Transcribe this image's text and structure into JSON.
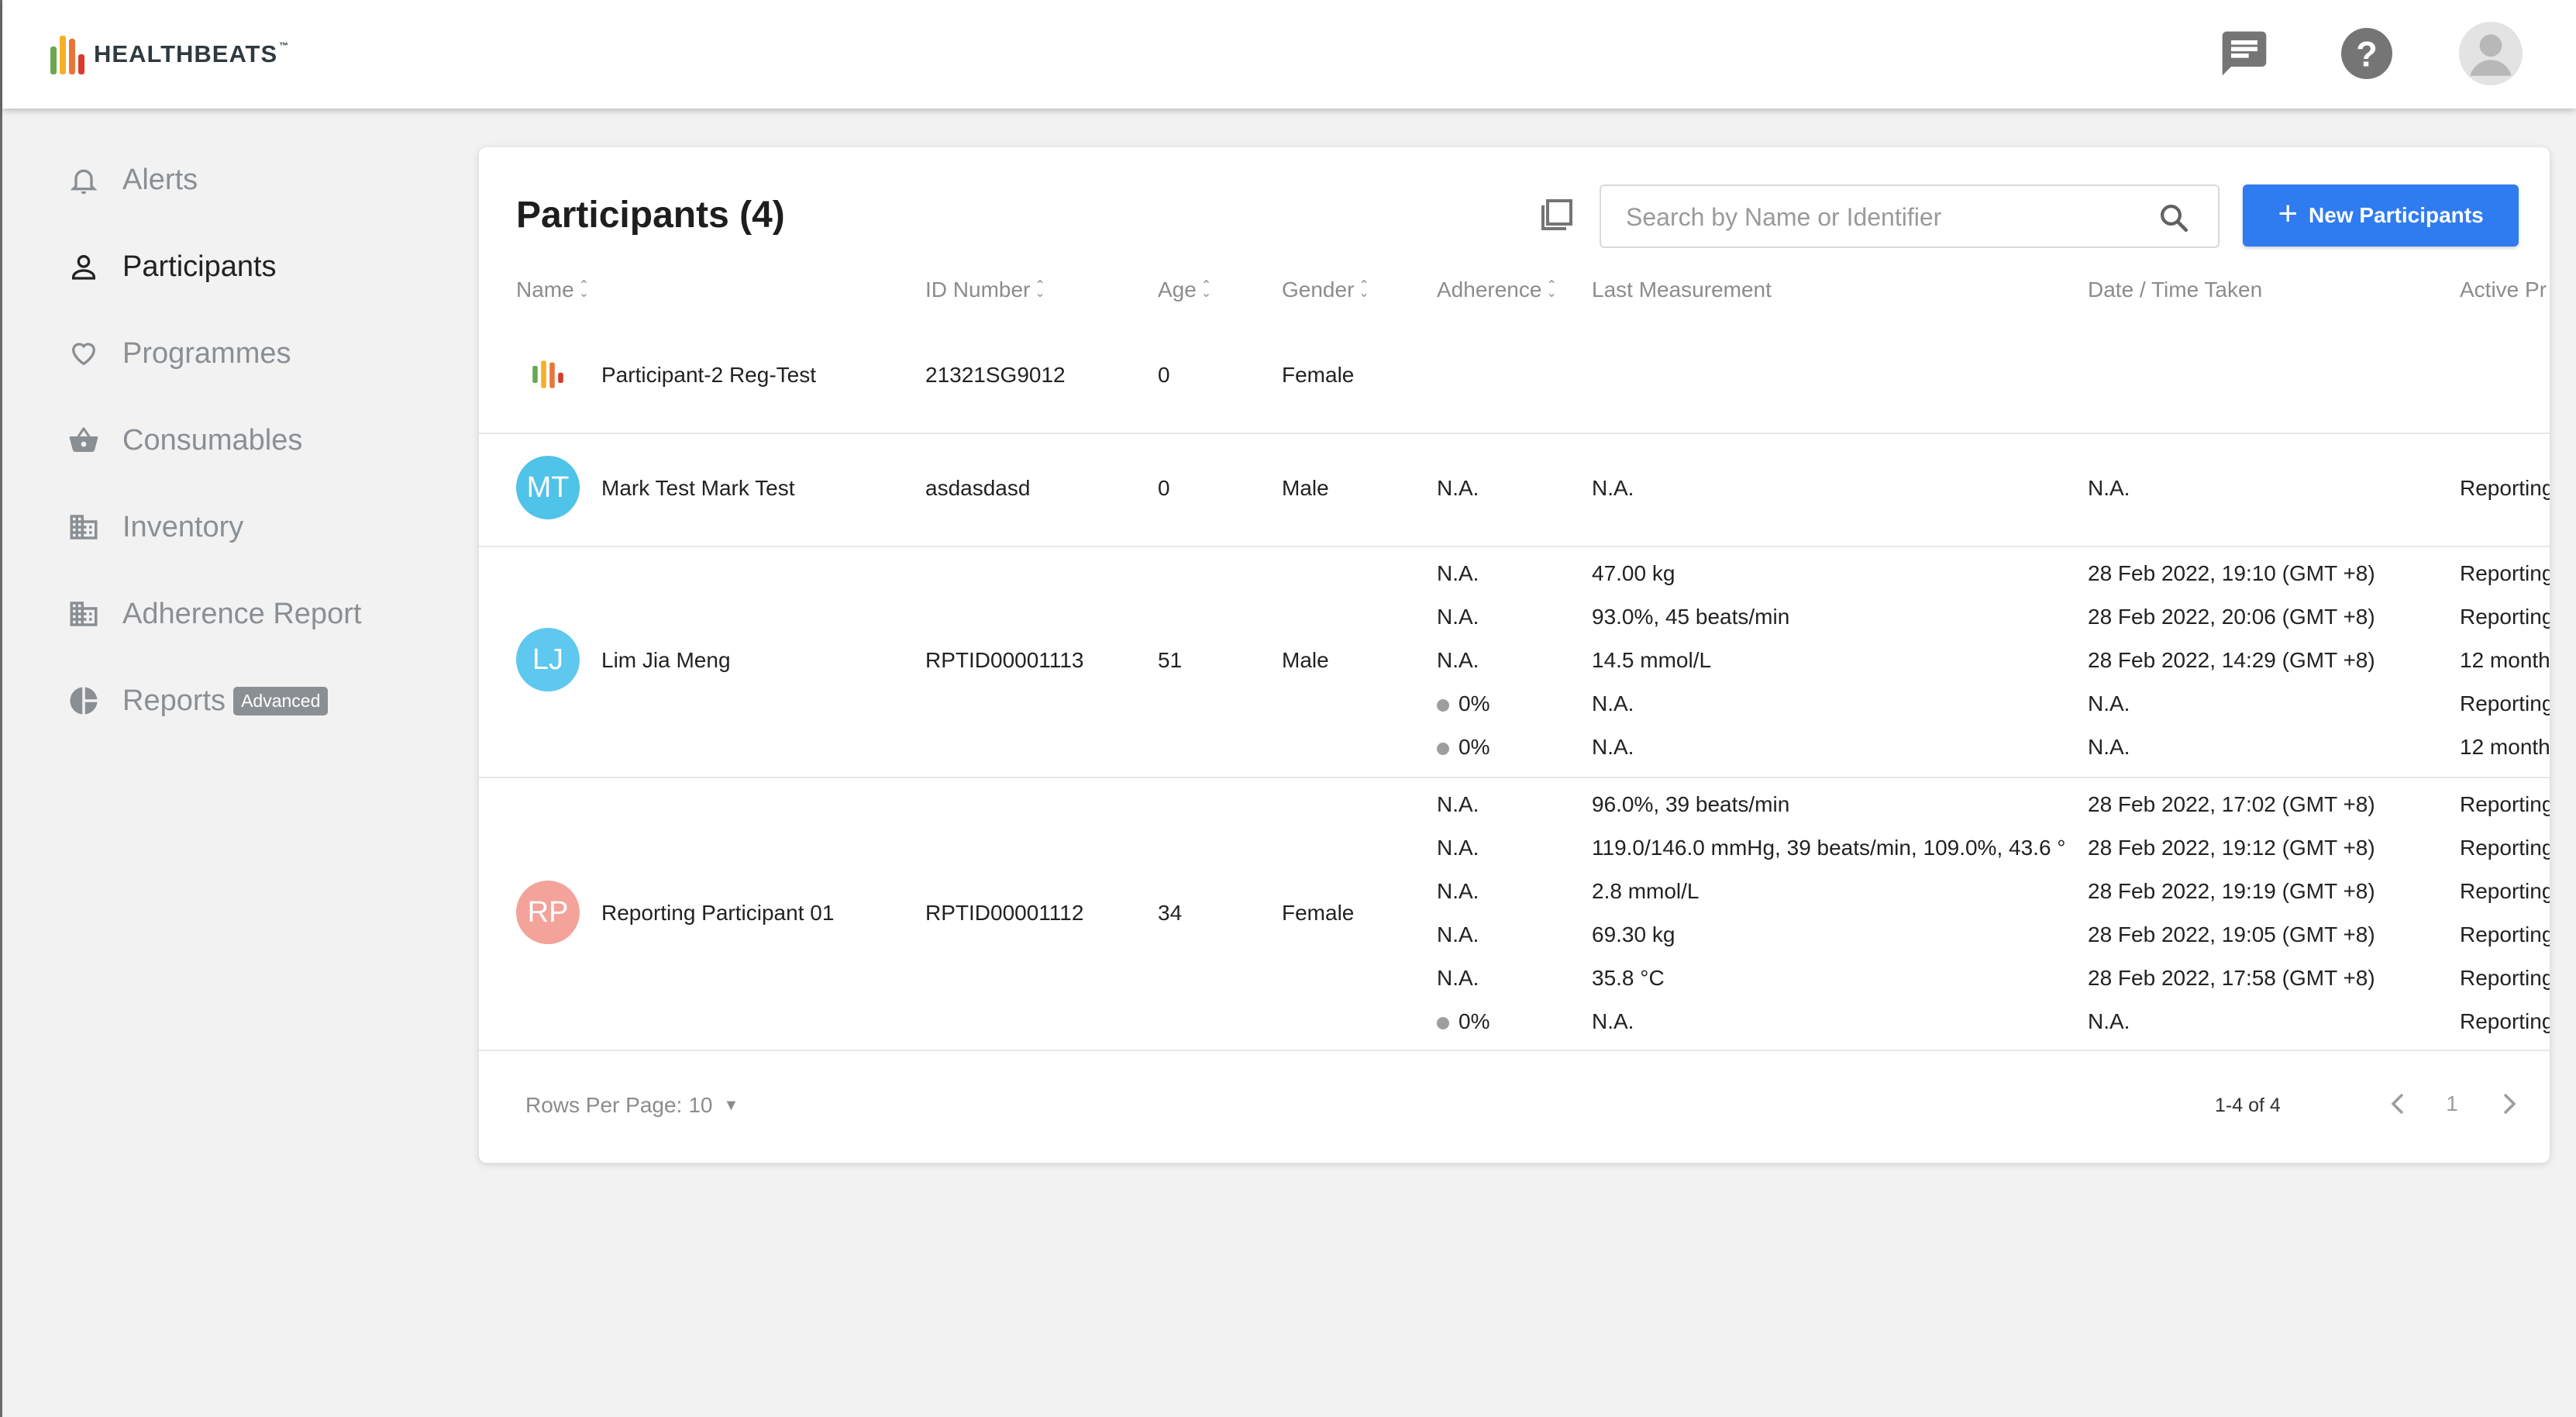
{
  "app": {
    "brand": "HEALTHBEATS",
    "trademark": "™"
  },
  "colors": {
    "accent": "#2f7bf0",
    "logo_bars": [
      "#6aa84f",
      "#f6b026",
      "#e8763a",
      "#d93a2b"
    ]
  },
  "header": {
    "icons": [
      "chat-icon",
      "help-icon",
      "user-avatar-icon"
    ]
  },
  "sidebar": {
    "items": [
      {
        "label": "Alerts",
        "icon": "bell-icon"
      },
      {
        "label": "Participants",
        "icon": "person-icon",
        "active": true
      },
      {
        "label": "Programmes",
        "icon": "heart-icon"
      },
      {
        "label": "Consumables",
        "icon": "basket-icon"
      },
      {
        "label": "Inventory",
        "icon": "building-icon"
      },
      {
        "label": "Adherence Report",
        "icon": "building-icon"
      },
      {
        "label": "Reports",
        "icon": "pie-chart-icon",
        "badge": "Advanced"
      }
    ]
  },
  "main": {
    "title": "Participants (4)",
    "search": {
      "placeholder": "Search by Name or Identifier",
      "value": ""
    },
    "new_button": "New Participants",
    "columns": [
      "Name",
      "ID Number",
      "Age",
      "Gender",
      "Adherence",
      "Last Measurement",
      "Date / Time Taken",
      "Active Pr"
    ],
    "rows": [
      {
        "avatar": "logo",
        "name": "Participant-2 Reg-Test",
        "id": "21321SG9012",
        "age": "0",
        "gender": "Female",
        "measurements": []
      },
      {
        "avatar": "MT",
        "avatar_color": "#4fc3e8",
        "name": "Mark Test Mark Test",
        "id": "asdasdasd",
        "age": "0",
        "gender": "Male",
        "measurements": [
          {
            "adherence": "N.A.",
            "value": "N.A.",
            "date": "N.A.",
            "active": "Reporting"
          }
        ]
      },
      {
        "avatar": "LJ",
        "avatar_color": "#5ec8ee",
        "name": "Lim Jia Meng",
        "id": "RPTID00001113",
        "age": "51",
        "gender": "Male",
        "measurements": [
          {
            "adherence": "N.A.",
            "value": "47.00 kg",
            "date": "28 Feb 2022, 19:10 (GMT +8)",
            "active": "Reporting"
          },
          {
            "adherence": "N.A.",
            "value": "93.0%, 45 beats/min",
            "date": "28 Feb 2022, 20:06 (GMT +8)",
            "active": "Reporting"
          },
          {
            "adherence": "N.A.",
            "value": "14.5 mmol/L",
            "date": "28 Feb 2022, 14:29 (GMT +8)",
            "active": "12 month"
          },
          {
            "adherence": "0%",
            "value": "N.A.",
            "date": "N.A.",
            "active": "Reporting"
          },
          {
            "adherence": "0%",
            "value": "N.A.",
            "date": "N.A.",
            "active": "12 month"
          }
        ]
      },
      {
        "avatar": "RP",
        "avatar_color": "#f3a39a",
        "name": "Reporting Participant 01",
        "id": "RPTID00001112",
        "age": "34",
        "gender": "Female",
        "measurements": [
          {
            "adherence": "N.A.",
            "value": "96.0%, 39 beats/min",
            "date": "28 Feb 2022, 17:02 (GMT +8)",
            "active": "Reporting"
          },
          {
            "adherence": "N.A.",
            "value": "119.0/146.0 mmHg, 39 beats/min, 109.0%, 43.6 °",
            "date": "28 Feb 2022, 19:12 (GMT +8)",
            "active": "Reporting"
          },
          {
            "adherence": "N.A.",
            "value": "2.8 mmol/L",
            "date": "28 Feb 2022, 19:19 (GMT +8)",
            "active": "Reporting"
          },
          {
            "adherence": "N.A.",
            "value": "69.30 kg",
            "date": "28 Feb 2022, 19:05 (GMT +8)",
            "active": "Reporting"
          },
          {
            "adherence": "N.A.",
            "value": "35.8 °C",
            "date": "28 Feb 2022, 17:58 (GMT +8)",
            "active": "Reporting"
          },
          {
            "adherence": "0%",
            "value": "N.A.",
            "date": "N.A.",
            "active": "Reporting"
          }
        ]
      }
    ],
    "footer": {
      "rows_per_page_label": "Rows Per Page:",
      "rows_per_page_value": "10",
      "range": "1-4 of 4",
      "page": "1"
    }
  }
}
